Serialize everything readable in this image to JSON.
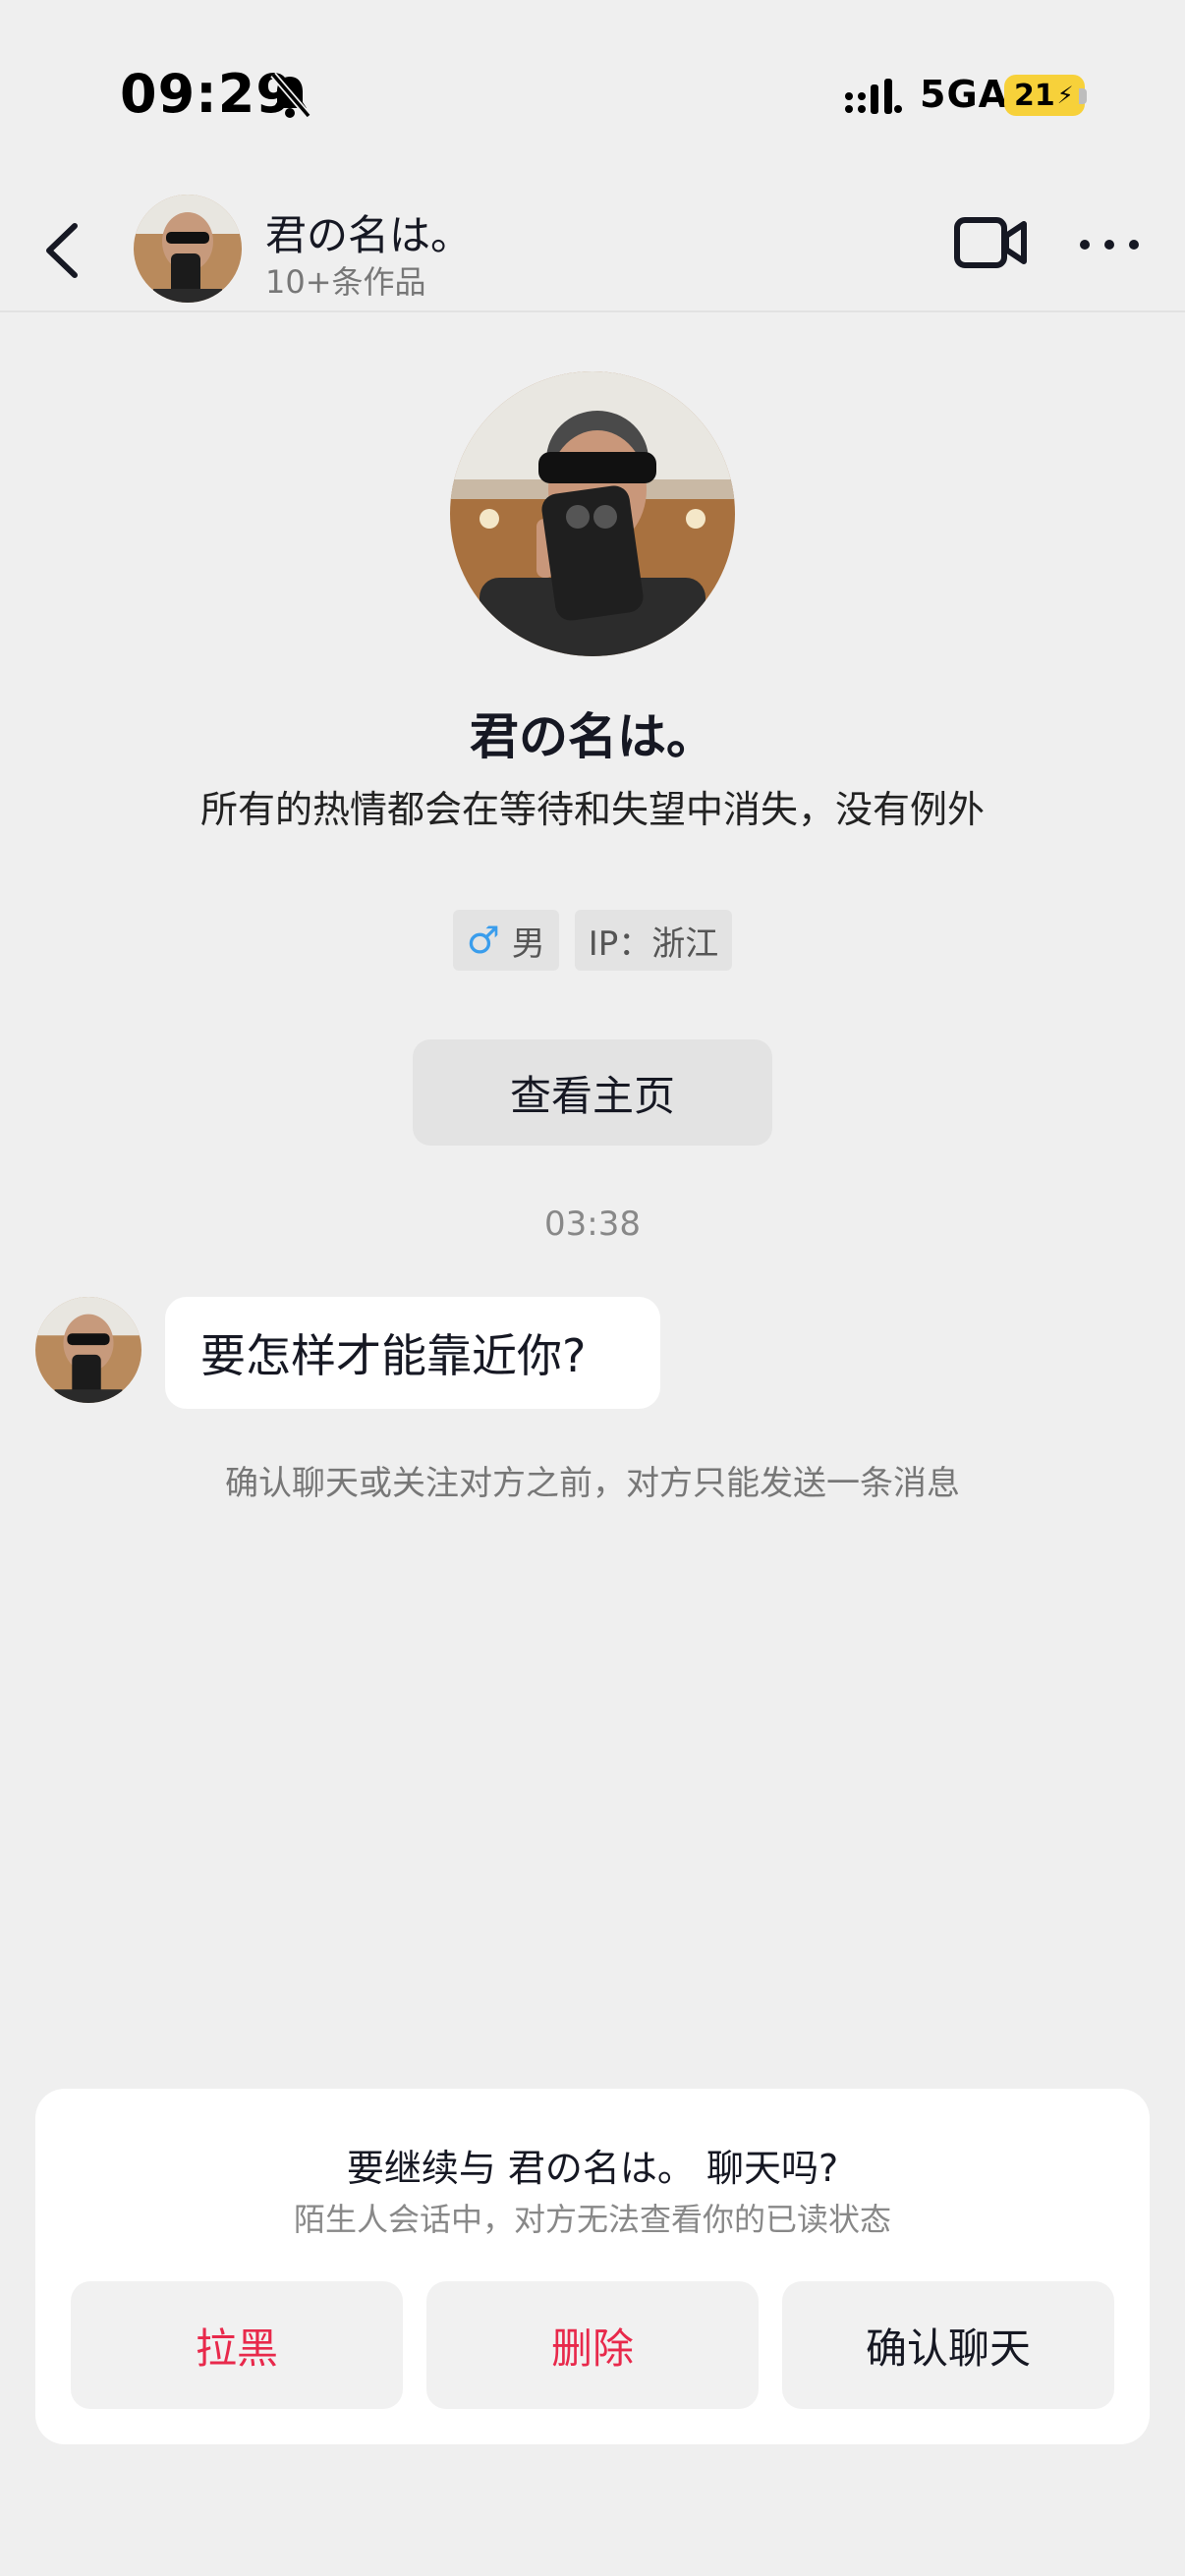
{
  "status_bar": {
    "time": "09:29",
    "network": "5GA",
    "battery": "21"
  },
  "header": {
    "name": "君の名は。",
    "subtitle": "10+条作品"
  },
  "profile": {
    "name": "君の名は。",
    "bio": "所有的热情都会在等待和失望中消失，没有例外",
    "gender": "男",
    "ip": "IP：浙江",
    "homepage_button": "查看主页"
  },
  "chat": {
    "time": "03:38",
    "message": "要怎样才能靠近你?",
    "notice": "确认聊天或关注对方之前，对方只能发送一条消息"
  },
  "confirm_card": {
    "title": "要继续与 君の名は。 聊天吗?",
    "subtitle": "陌生人会话中，对方无法查看你的已读状态",
    "block_button": "拉黑",
    "delete_button": "删除",
    "confirm_button": "确认聊天"
  },
  "colors": {
    "background": "#efefef",
    "danger": "#e8294b",
    "battery": "#f7d13a",
    "male": "#3a9dec"
  }
}
